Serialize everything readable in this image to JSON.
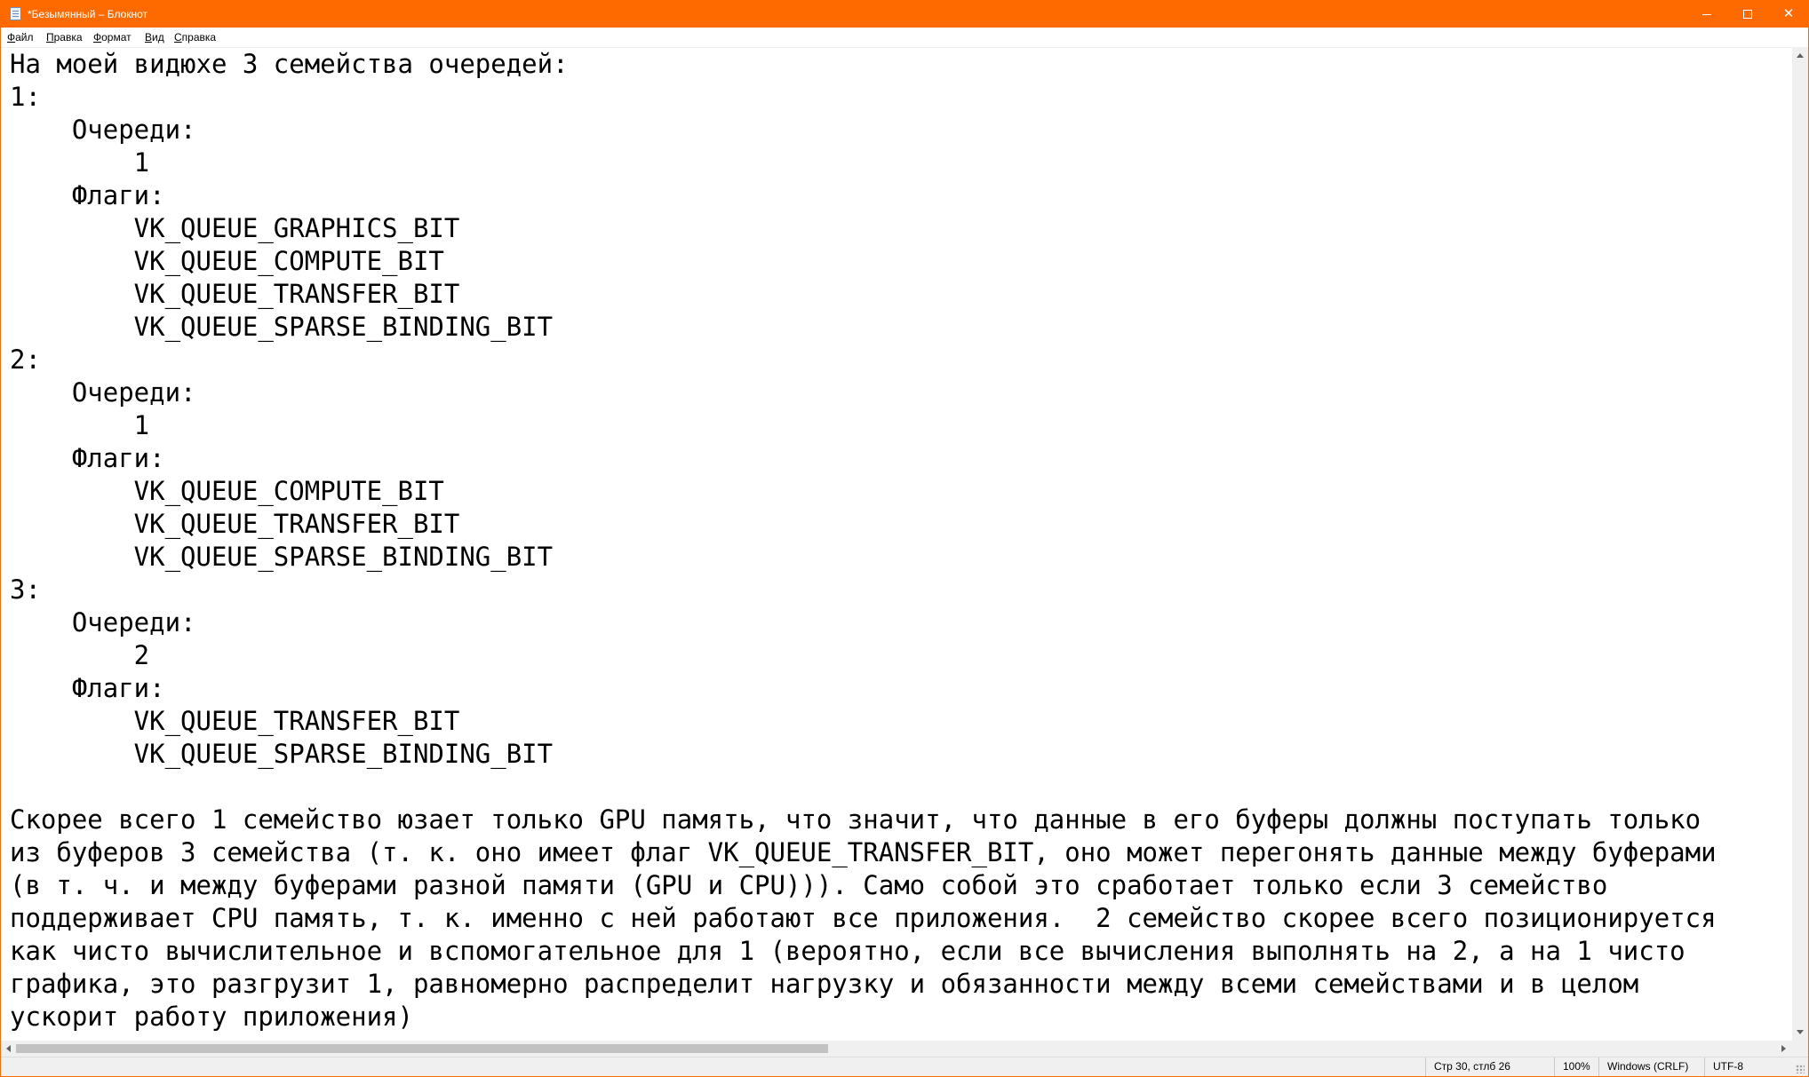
{
  "window": {
    "title": "*Безымянный – Блокнот",
    "accent_color": "#ff6a00",
    "controls": [
      "minimize-icon",
      "maximize-icon",
      "close-icon"
    ],
    "close_glyph": "✕"
  },
  "menu": {
    "items": [
      "Файл",
      "Правка",
      "Формат",
      "Вид",
      "Справка"
    ]
  },
  "editor": {
    "lines": [
      "На моей видюхе 3 семейства очередей:",
      "1:",
      "    Очереди:",
      "        1",
      "    Флаги:",
      "        VK_QUEUE_GRAPHICS_BIT",
      "        VK_QUEUE_COMPUTE_BIT",
      "        VK_QUEUE_TRANSFER_BIT",
      "        VK_QUEUE_SPARSE_BINDING_BIT",
      "2:",
      "    Очереди:",
      "        1",
      "    Флаги:",
      "        VK_QUEUE_COMPUTE_BIT",
      "        VK_QUEUE_TRANSFER_BIT",
      "        VK_QUEUE_SPARSE_BINDING_BIT",
      "3:",
      "    Очереди:",
      "        2",
      "    Флаги:",
      "        VK_QUEUE_TRANSFER_BIT",
      "        VK_QUEUE_SPARSE_BINDING_BIT",
      "",
      "Скорее всего 1 семейство юзает только GPU память, что значит, что данные в его буферы должны поступать только",
      "из буферов 3 семейства (т. к. оно имеет флаг VK_QUEUE_TRANSFER_BIT, оно может перегонять данные между буферами",
      "(в т. ч. и между буферами разной памяти (GPU и CPU))). Само собой это сработает только если 3 семейство",
      "поддерживает CPU память, т. к. именно с ней работают все приложения.  2 семейство скорее всего позиционируется",
      "как чисто вычислительное и вспомогательное для 1 (вероятно, если все вычисления выполнять на 2, а на 1 чисто",
      "графика, это разгрузит 1, равномерно распределит нагрузку и обязанности между всеми семействами и в целом",
      "ускорит работу приложения)"
    ]
  },
  "status": {
    "position": "Стр 30, стлб 26",
    "zoom": "100%",
    "line_endings": "Windows (CRLF)",
    "encoding": "UTF-8"
  }
}
